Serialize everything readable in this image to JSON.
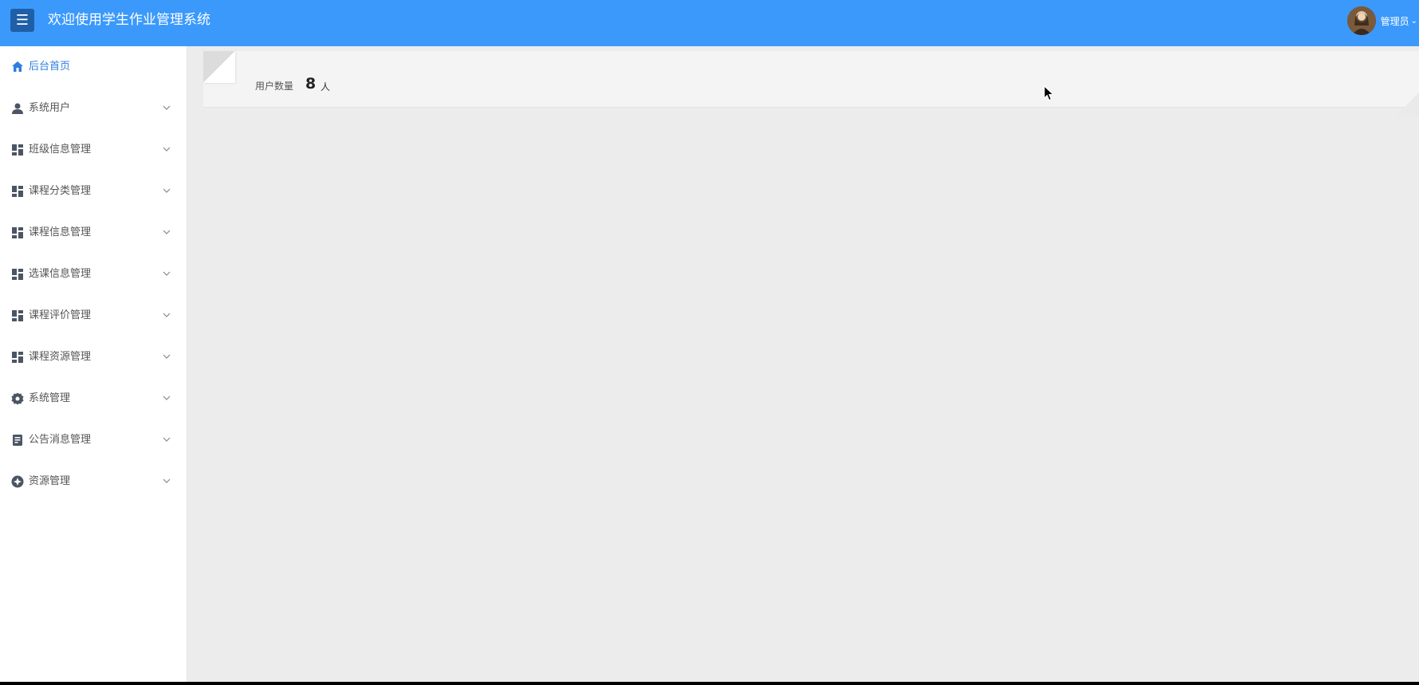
{
  "header": {
    "menu_icon": "hamburger-icon",
    "title": "欢迎使用学生作业管理系统",
    "user_name": "管理员",
    "user_chevron": "chevron-down-icon",
    "bg_color": "#3b99fc"
  },
  "sidebar": {
    "items": [
      {
        "label": "后台首页",
        "icon": "home-icon",
        "active": true
      },
      {
        "label": "系统用户",
        "icon": "user-icon"
      },
      {
        "label": "班级信息管理",
        "icon": "grid-icon"
      },
      {
        "label": "课程分类管理",
        "icon": "grid-icon"
      },
      {
        "label": "课程信息管理",
        "icon": "grid-icon"
      },
      {
        "label": "选课信息管理",
        "icon": "grid-icon"
      },
      {
        "label": "课程评价管理",
        "icon": "grid-icon"
      },
      {
        "label": "课程资源管理",
        "icon": "grid-icon"
      },
      {
        "label": "系统管理",
        "icon": "gear-icon"
      },
      {
        "label": "公告消息管理",
        "icon": "document-icon"
      },
      {
        "label": "资源管理",
        "icon": "compass-icon"
      }
    ],
    "active_color": "#2f7de1"
  },
  "main": {
    "stat": {
      "label": "用户数量",
      "value": "8",
      "unit": "人"
    }
  }
}
